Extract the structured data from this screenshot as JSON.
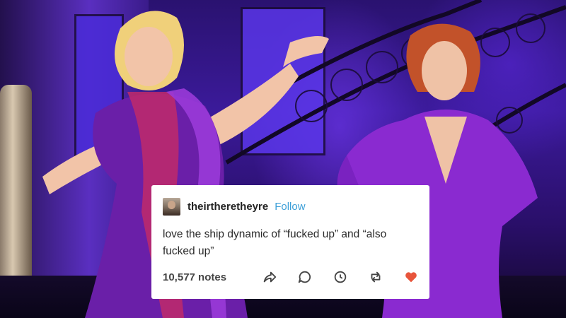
{
  "post": {
    "username": "theirtheretheyre",
    "follow_label": "Follow",
    "text": "love the ship dynamic of “fucked up” and “also fucked up”",
    "notes": "10,577 notes"
  },
  "icons": {
    "share": "share-arrow-icon",
    "reply": "reply-bubble-icon",
    "queue": "clock-icon",
    "reblog": "reblog-icon",
    "like": "heart-icon"
  },
  "colors": {
    "follow": "#3c9fd8",
    "heart": "#e8553c",
    "stage_purple": "#3b1a9a"
  }
}
